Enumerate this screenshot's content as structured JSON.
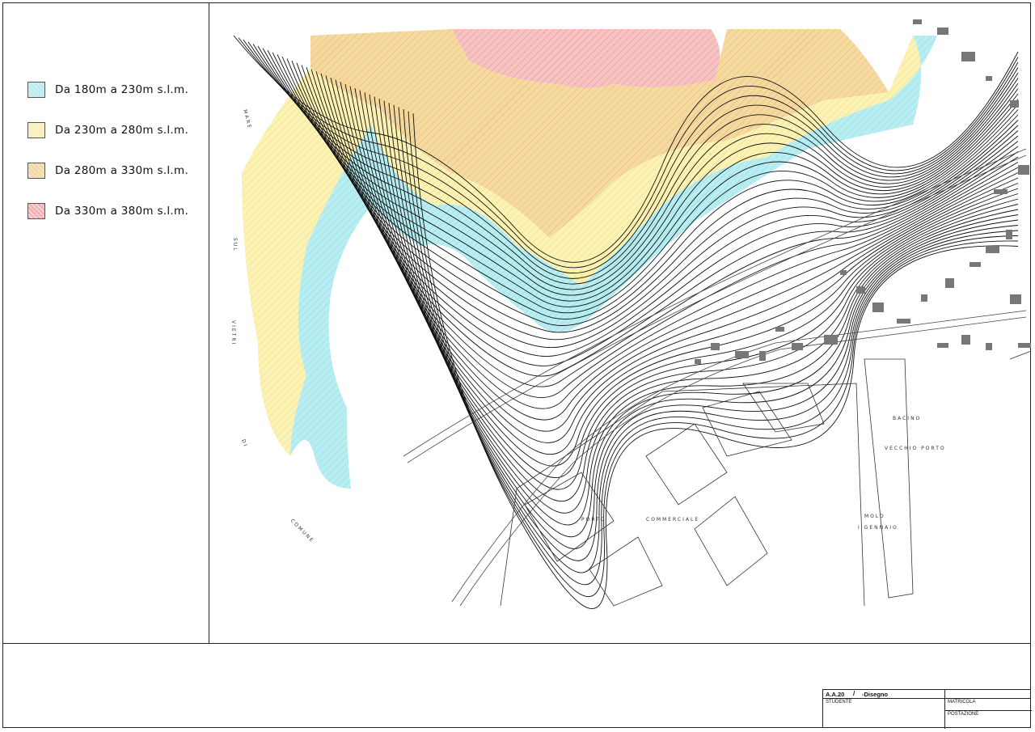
{
  "legend": {
    "items": [
      {
        "label": "Da  180m  a  230m  s.l.m.",
        "color": "#b8eef2"
      },
      {
        "label": "Da  230m  a  280m  s.l.m.",
        "color": "#fbf2b4"
      },
      {
        "label": "Da  280m  a  330m  s.l.m.",
        "color": "#f5d9a0"
      },
      {
        "label": "Da  330m  a  380m  s.l.m.",
        "color": "#f6b2b2"
      }
    ]
  },
  "map": {
    "labels": {
      "porto": "PORTO",
      "commerciale": "COMMERCIALE",
      "bacino": "BACINO",
      "vecchio_porto": "VECCHIO PORTO",
      "molo": "MOLO",
      "gennaio": "I GENNAIO",
      "mare": "MARE",
      "sul": "SUL",
      "vietri": "VIETRI",
      "di": "DI",
      "comune": "COMUNE"
    }
  },
  "title_block": {
    "course": "A.A.20",
    "separator": "/",
    "subject": "-Disegno",
    "student": "STUDENTE",
    "matricola": "MATRICOLA",
    "postazione": "POSTAZIONE"
  }
}
